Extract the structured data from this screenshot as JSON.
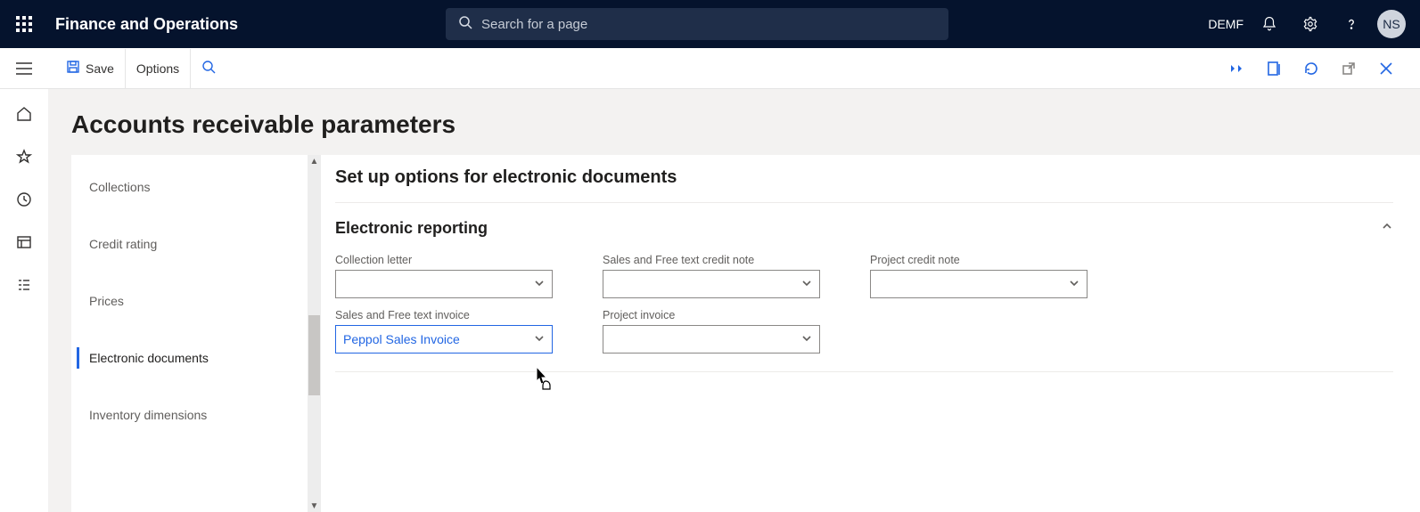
{
  "top": {
    "app_title": "Finance and Operations",
    "search_placeholder": "Search for a page",
    "env": "DEMF",
    "avatar": "NS"
  },
  "action": {
    "save": "Save",
    "options": "Options"
  },
  "page": {
    "title": "Accounts receivable parameters",
    "section_title": "Set up options for electronic documents"
  },
  "vnav": {
    "items": [
      {
        "label": "Collections",
        "active": false
      },
      {
        "label": "Credit rating",
        "active": false
      },
      {
        "label": "Prices",
        "active": false
      },
      {
        "label": "Electronic documents",
        "active": true
      },
      {
        "label": "Inventory dimensions",
        "active": false
      }
    ]
  },
  "fasttab": {
    "title": "Electronic reporting",
    "fields": {
      "collection_letter": {
        "label": "Collection letter",
        "value": ""
      },
      "sales_credit_note": {
        "label": "Sales and Free text credit note",
        "value": ""
      },
      "project_credit_note": {
        "label": "Project credit note",
        "value": ""
      },
      "sales_invoice": {
        "label": "Sales and Free text invoice",
        "value": "Peppol Sales Invoice"
      },
      "project_invoice": {
        "label": "Project invoice",
        "value": ""
      }
    }
  }
}
